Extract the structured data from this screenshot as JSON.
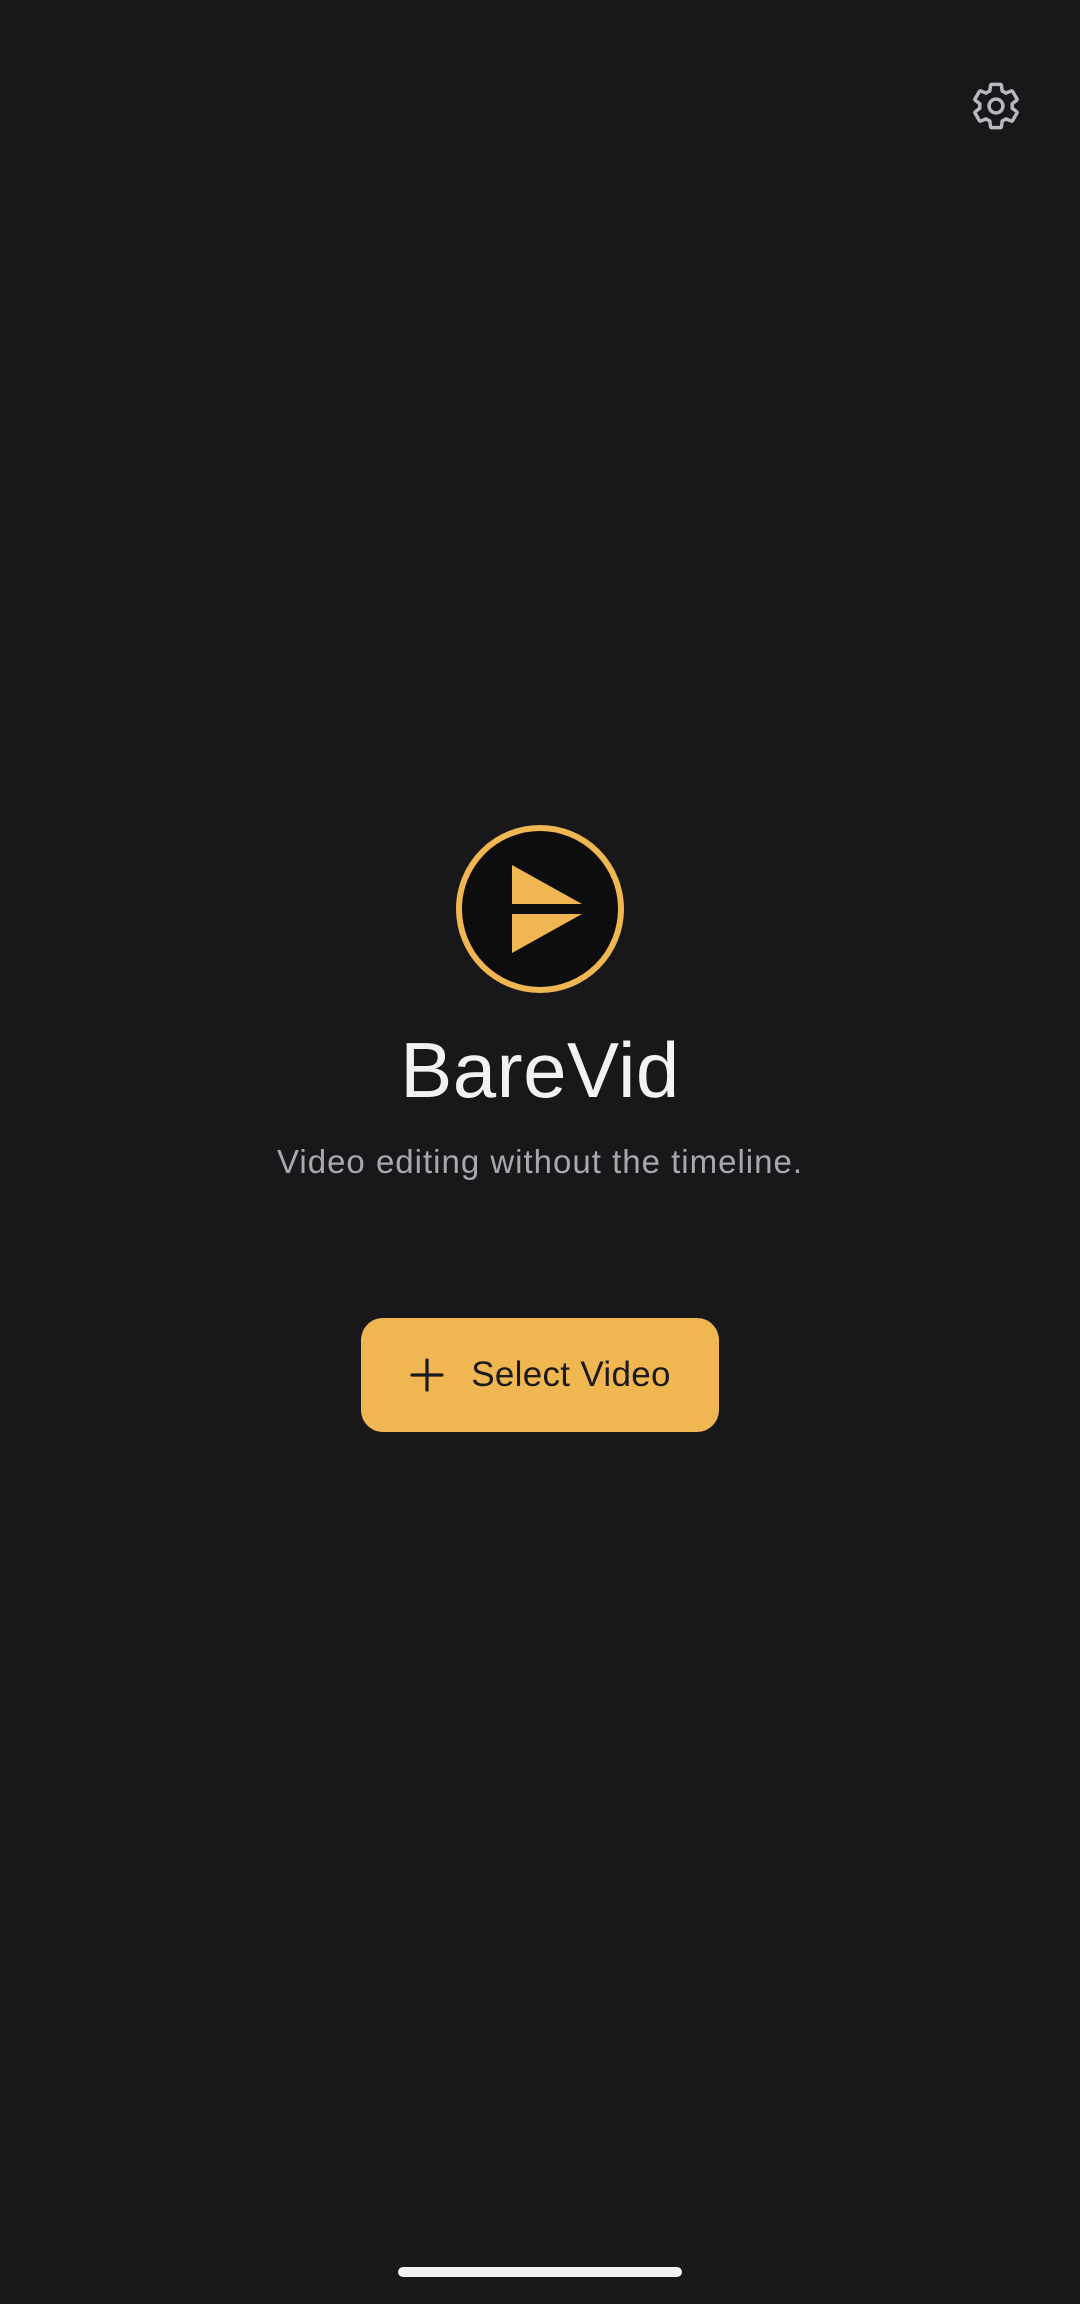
{
  "app": {
    "title": "BareVid",
    "tagline": "Video editing without the timeline."
  },
  "header": {
    "settings_icon": "gear-icon"
  },
  "logo": {
    "icon": "play-split-icon"
  },
  "actions": {
    "select_video_label": "Select Video",
    "select_video_icon": "plus-icon"
  },
  "colors": {
    "background": "#18171a",
    "accent": "#f0b652",
    "title_text": "#f2f2f2",
    "subtitle_text": "#a9a9ad",
    "button_text": "#1b1a1d",
    "logo_fill": "#0d0d0e"
  }
}
